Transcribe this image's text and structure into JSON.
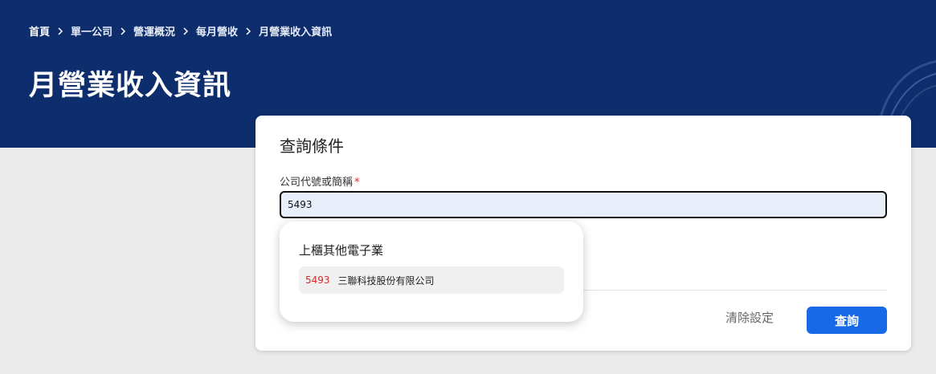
{
  "breadcrumb": {
    "home": "首頁",
    "items": [
      "單一公司",
      "營運概況",
      "每月營收",
      "月營業收入資訊"
    ]
  },
  "page_title": "月營業收入資訊",
  "query_card": {
    "title": "查詢條件",
    "company_field": {
      "label": "公司代號或簡稱",
      "required_mark": "*",
      "value": "5493"
    },
    "clear_label": "清除設定",
    "submit_label": "查詢"
  },
  "suggestions": {
    "group_label": "上櫃其他電子業",
    "items": [
      {
        "code": "5493",
        "name": "三聯科技股份有限公司"
      }
    ]
  },
  "colors": {
    "hero_bg": "#0e2d6c",
    "primary_button": "#1769e8",
    "required": "#e02424",
    "code_highlight": "#d42a2a"
  }
}
